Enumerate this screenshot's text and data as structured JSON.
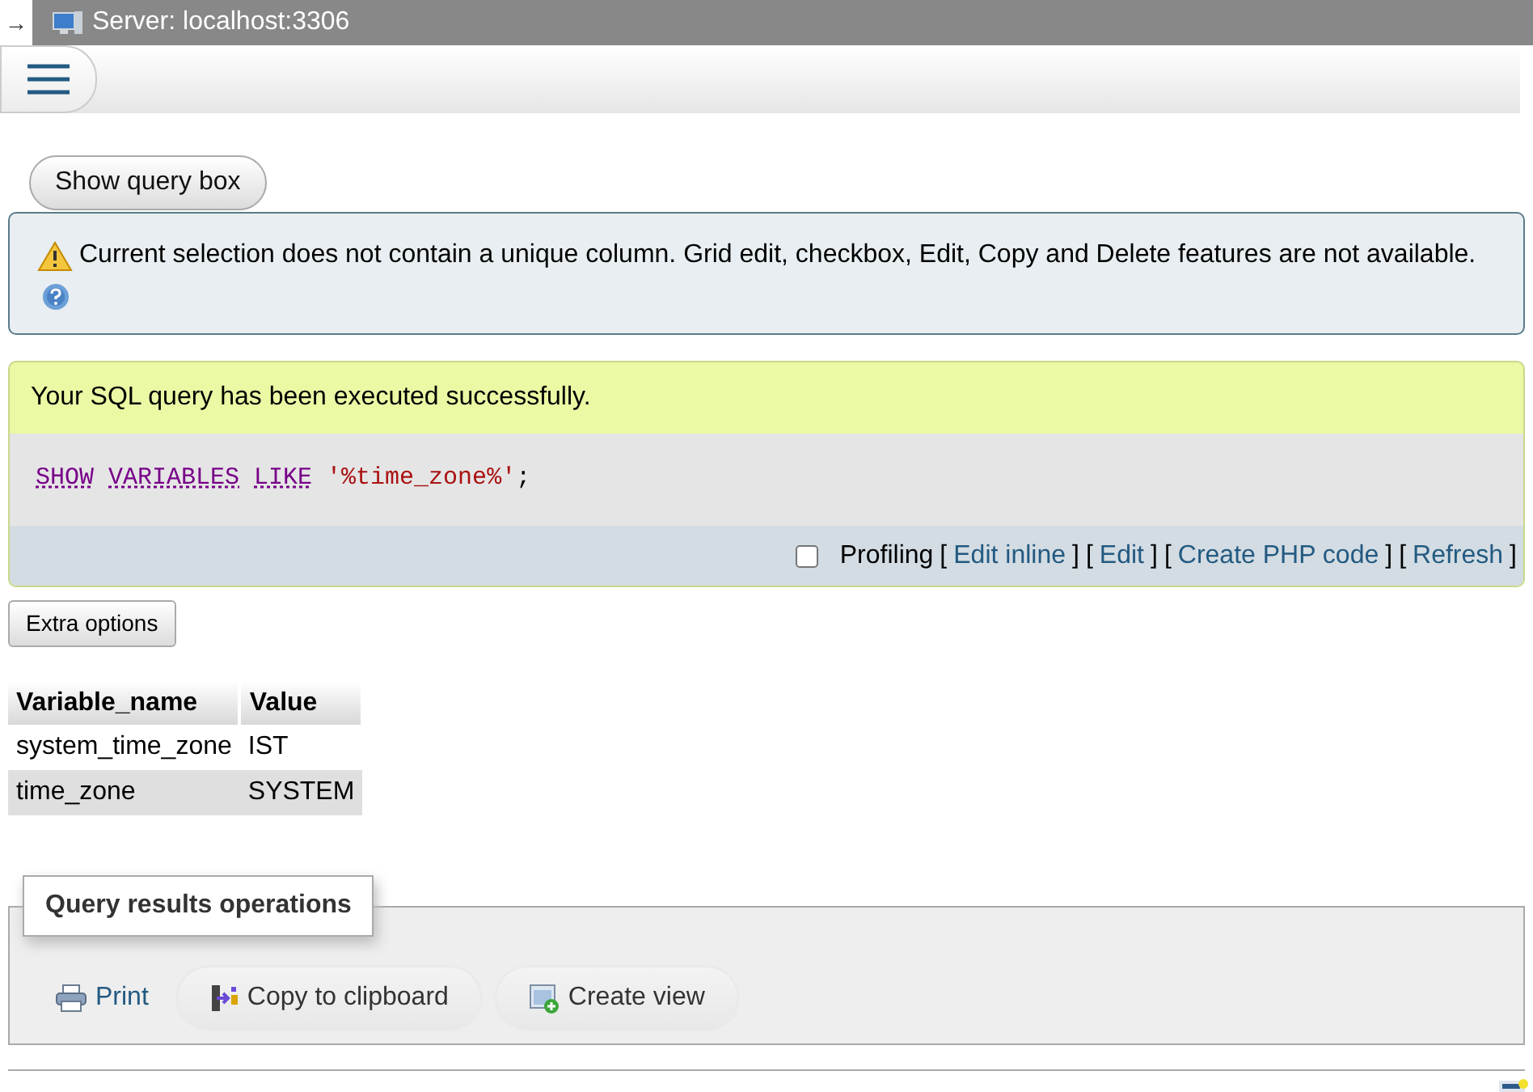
{
  "top_bar": {
    "arrow": "→",
    "title": "Server: localhost:3306"
  },
  "show_query_button": "Show query box",
  "notice": {
    "message": "Current selection does not contain a unique column. Grid edit, checkbox, Edit, Copy and Delete features are not available."
  },
  "success": {
    "message": "Your SQL query has been executed successfully.",
    "sql": [
      {
        "kind": "keyword",
        "text": "SHOW"
      },
      {
        "kind": "keyword",
        "text": "VARIABLES"
      },
      {
        "kind": "keyword",
        "text": "LIKE"
      },
      {
        "kind": "string",
        "text": "'%time_zone%'"
      },
      {
        "kind": "punct",
        "text": ";"
      }
    ],
    "profiling": {
      "label": "Profiling",
      "checked": false
    },
    "links": [
      {
        "open": "[",
        "label": "Edit inline",
        "close": "]"
      },
      {
        "open": "[",
        "label": "Edit",
        "close": "]"
      },
      {
        "open": "[",
        "label": "Create PHP code",
        "close": "]"
      },
      {
        "open": "[",
        "label": "Refresh",
        "close": "]"
      }
    ]
  },
  "extra_options_button": "Extra options",
  "table": {
    "columns": [
      "Variable_name",
      "Value"
    ],
    "rows": [
      [
        "system_time_zone",
        "IST"
      ],
      [
        "time_zone",
        "SYSTEM"
      ]
    ]
  },
  "operations": {
    "legend": "Query results operations",
    "actions": [
      {
        "kind": "print",
        "label": "Print"
      },
      {
        "kind": "copy",
        "label": "Copy to clipboard"
      },
      {
        "kind": "view",
        "label": "Create view"
      }
    ]
  }
}
